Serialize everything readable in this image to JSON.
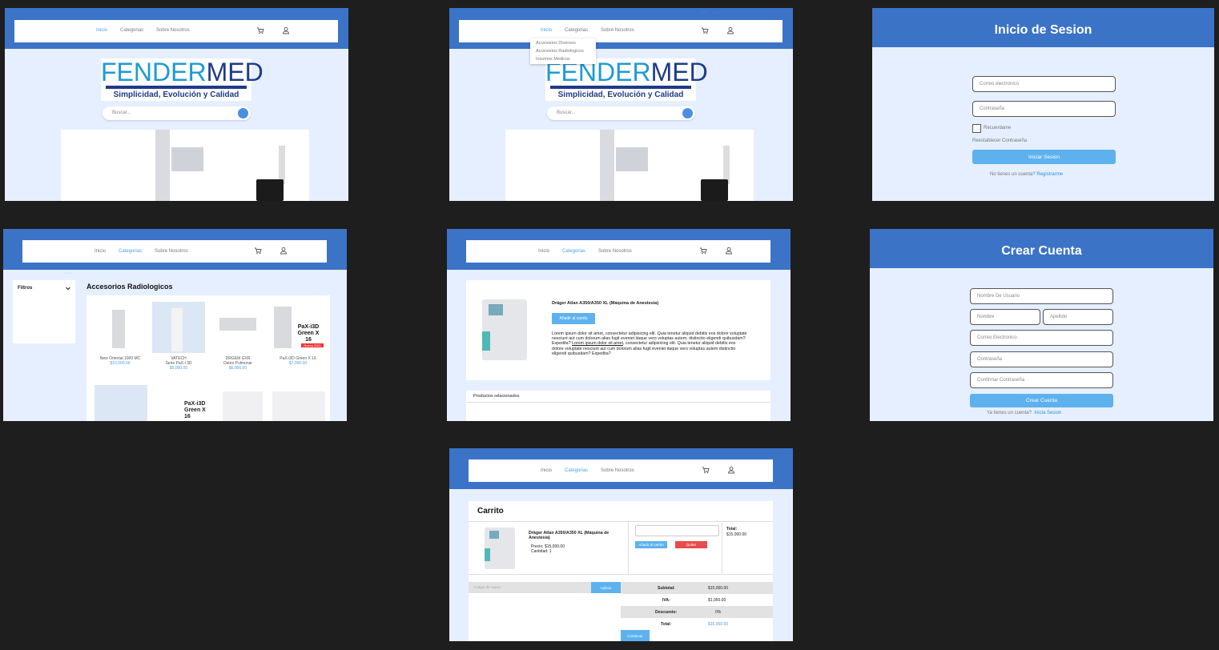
{
  "nav": {
    "home": "Inicio",
    "categories": "Categorias",
    "about": "Sobre Nosotros"
  },
  "logo": {
    "brand_a": "FENDER",
    "brand_b": "MED",
    "tagline": "Simplicidad, Evolución y Calidad"
  },
  "search": {
    "placeholder": "Buscar..."
  },
  "dropdown": {
    "items": [
      "Accesorios Diversos",
      "Accesorios Radiologicos",
      "Insumos Medicos"
    ]
  },
  "login": {
    "title": "Inicio de Sesion",
    "email_ph": "Correo electronico",
    "password_ph": "Contraseña",
    "remember": "Recuerdame",
    "reset": "Reestablecer Contraseña",
    "submit": "Iniciar Sesion",
    "no_account": "No tienes un cuenta?",
    "register": "Registrarme"
  },
  "catalog": {
    "filters": "Filtros",
    "heading": "Accesorios Radiologicos",
    "products": [
      {
        "name": "New Oriental 1000 MC",
        "name2": "",
        "price": "$10,000.00"
      },
      {
        "name": "VATECH",
        "name2": "Serie PaX-i 3D",
        "price": "$5,000.00"
      },
      {
        "name": "DRGEM GXR",
        "name2": "Osteo Pulmonar",
        "price": "$6,000.00"
      },
      {
        "name": "PaX-i3D Green X 16",
        "name2": "",
        "price": "$7,000.00"
      }
    ],
    "pax_label": "PaX-i3D Green X 16",
    "pax_badge": "Nuevo 2021"
  },
  "product_detail": {
    "title": "Dräger Atlan A350/A350 XL (Máquina de Anestesia)",
    "add_to_cart": "Añadir al carrito",
    "desc_1": "Lorem ipsum dolor sit amet, consectetur adipisicing elit. Quia tenetur aliquid debitis eos dolore voluptate nesciunt aut cum dolorum alias fugit eveniet itaque vero voluptas autem, distinctio eligendi quibusdam? Expedita?",
    "desc_link": "Lorem ipsum dolor sit amet",
    "desc_2": ", consectetur adipisicing elit. Quia tenetur aliquid debitis eos dolore voluptate nesciunt aut cum dolorum alias fugit eveniet itaque vero voluptas autem distinctio eligendi quibusdam? Expedita?",
    "related": "Productos relacionados"
  },
  "register": {
    "title": "Crear Cuenta",
    "username": "Nombre De Usuario",
    "first": "Nombre",
    "last": "Apellido",
    "email": "Correo Electronico",
    "password": "Contraseña",
    "confirm": "Confirmar Contraseña",
    "submit": "Crear Cuenta",
    "have_account": "Ya tienes un cuenta?",
    "login": "Inicia Sesion"
  },
  "cart": {
    "title": "Carrito",
    "item_title": "Dräger Atlan A350/A350 XL (Máquina de Anestesia)",
    "price": "Precio: $15,000.00",
    "qty": "Cantidad: 1",
    "add": "Añadir al carrito",
    "remove": "Quitar",
    "total_label": "Total:",
    "total_value": "$15,000.00",
    "coupon_ph": "Codigo de cupon",
    "apply": "Aplicar",
    "summary": [
      {
        "label": "Subtotal:",
        "value": "$15,000.00"
      },
      {
        "label": "IVA:",
        "value": "$1,950.00"
      },
      {
        "label": "Descuento:",
        "value": "0%"
      },
      {
        "label": "Total:",
        "value": "$16,950.00"
      }
    ],
    "continue": "Continuar"
  },
  "colors": {
    "band": "#3b73c7",
    "bg": "#e6efff",
    "accent": "#5db2ee",
    "danger": "#e84c4c"
  }
}
